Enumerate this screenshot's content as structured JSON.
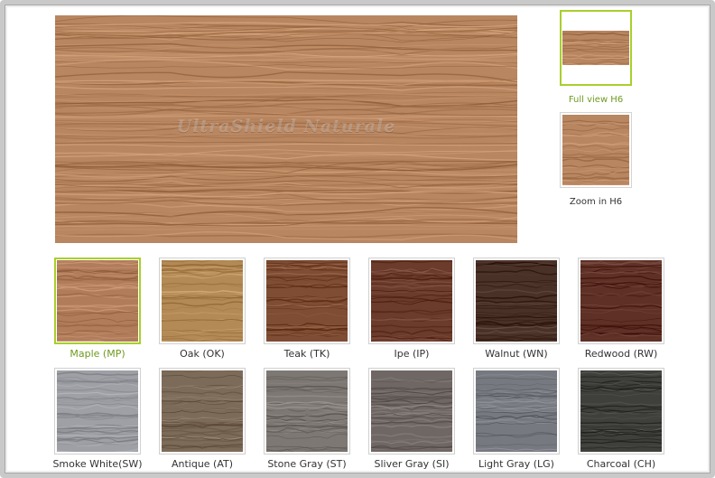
{
  "preview": {
    "watermark": "UltraShield Naturale",
    "color": "#b88660"
  },
  "views": [
    {
      "label": "Full view H6",
      "selected": true
    },
    {
      "label": "Zoom in H6",
      "selected": false
    }
  ],
  "swatches": [
    {
      "label": "Maple (MP)",
      "color": "#b07c5a",
      "selected": true
    },
    {
      "label": "Oak (OK)",
      "color": "#b38a55",
      "selected": false
    },
    {
      "label": "Teak (TK)",
      "color": "#7e4d33",
      "selected": false
    },
    {
      "label": "Ipe (IP)",
      "color": "#6b3b2c",
      "selected": false
    },
    {
      "label": "Walnut (WN)",
      "color": "#4a3127",
      "selected": false
    },
    {
      "label": "Redwood (RW)",
      "color": "#5e3026",
      "selected": false
    },
    {
      "label": "Smoke White(SW)",
      "color": "#9ea0a6",
      "selected": false
    },
    {
      "label": "Antique (AT)",
      "color": "#7d6b59",
      "selected": false
    },
    {
      "label": "Stone Gray (ST)",
      "color": "#7d7873",
      "selected": false
    },
    {
      "label": "Sliver Gray (SI)",
      "color": "#6f6764",
      "selected": false
    },
    {
      "label": "Light Gray (LG)",
      "color": "#777980",
      "selected": false
    },
    {
      "label": "Charcoal (CH)",
      "color": "#3f3f3b",
      "selected": false
    }
  ]
}
